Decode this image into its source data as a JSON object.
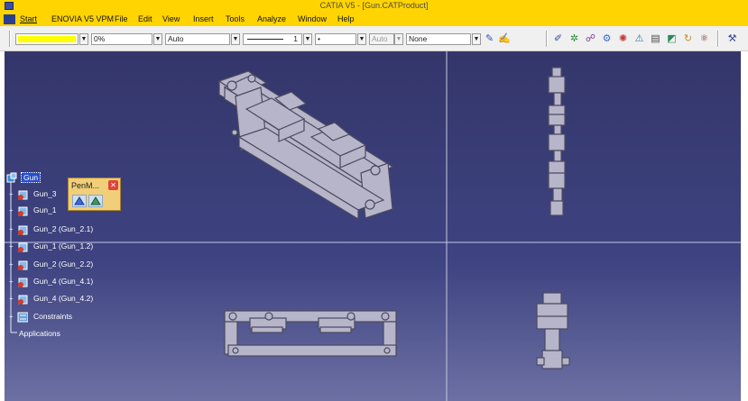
{
  "window": {
    "title": "CATIA V5 - [Gun.CATProduct]"
  },
  "menubar": {
    "items": [
      "Start",
      "ENOVIA V5 VPM",
      "File",
      "Edit",
      "View",
      "Insert",
      "Tools",
      "Analyze",
      "Window",
      "Help"
    ]
  },
  "toolbar": {
    "color_select": "",
    "transparency_value": "0%",
    "linetype_value": "Auto",
    "thickness_value": "1",
    "point_value": "•",
    "layer_auto_value": "Auto",
    "layer_value": "None"
  },
  "tree": {
    "root": "Gun",
    "items": [
      {
        "label": "Gun_3"
      },
      {
        "label": "Gun_1"
      },
      {
        "label": "Gun_2 (Gun_2.1)"
      },
      {
        "label": "Gun_1 (Gun_1.2)"
      },
      {
        "label": "Gun_2 (Gun_2.2)"
      },
      {
        "label": "Gun_4 (Gun_4.1)"
      },
      {
        "label": "Gun_4 (Gun_4.2)"
      },
      {
        "label": "Constraints"
      },
      {
        "label": "Applications"
      }
    ]
  },
  "penm_toolbar": {
    "title": "PenM..."
  },
  "colors": {
    "title_bar": "#ffd400",
    "viewport_top": "#34366a",
    "viewport_bottom": "#6c70a3",
    "part_fill": "#b7b5c9",
    "part_stroke": "#4b4a60"
  }
}
